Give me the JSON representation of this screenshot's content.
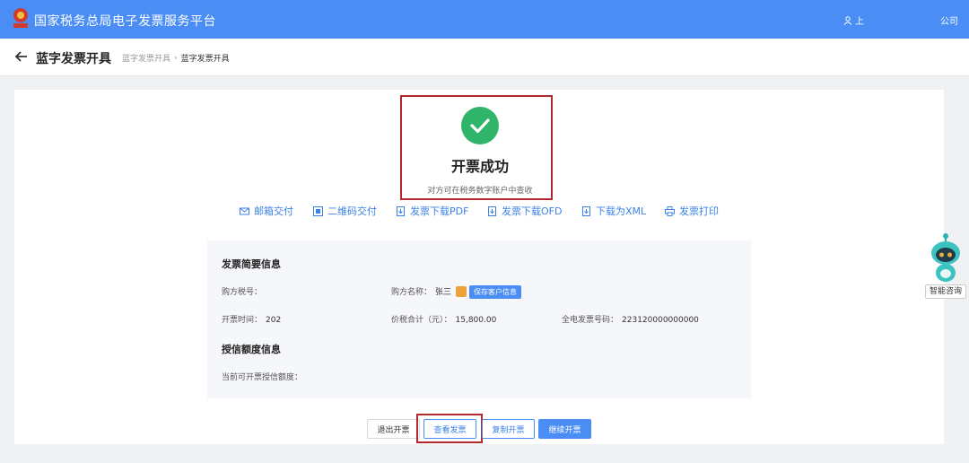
{
  "header": {
    "app_title": "国家税务总局电子发票服务平台",
    "user": "上",
    "company": "公司"
  },
  "subheader": {
    "page_title": "蓝字发票开具",
    "breadcrumb": [
      "蓝字发票开具",
      "蓝字发票开具"
    ]
  },
  "result": {
    "title": "开票成功",
    "subtitle": "对方可在税务数字账户中查收"
  },
  "actions": [
    {
      "label": "邮箱交付",
      "icon": "mail-icon"
    },
    {
      "label": "二维码交付",
      "icon": "qrcode-icon"
    },
    {
      "label": "发票下载PDF",
      "icon": "download-pdf-icon"
    },
    {
      "label": "发票下载OFD",
      "icon": "download-ofd-icon"
    },
    {
      "label": "下载为XML",
      "icon": "download-xml-icon"
    },
    {
      "label": "发票打印",
      "icon": "printer-icon"
    }
  ],
  "summary": {
    "title": "发票简要信息",
    "buyer_tax_id_label": "购方税号：",
    "buyer_tax_id": "",
    "buyer_name_label": "购方名称：",
    "buyer_name": "张三",
    "save_customer_label": "保存客户信息",
    "issue_time_label": "开票时间：",
    "issue_time": "202",
    "total_label": "价税合计（元）：",
    "total": "15,800.00",
    "invoice_no_label": "全电发票号码：",
    "invoice_no": "223120000000000"
  },
  "credit": {
    "title": "授信额度信息",
    "available_label": "当前可开票授信额度：",
    "available": ""
  },
  "buttons": {
    "exit": "退出开票",
    "view": "查看发票",
    "copy": "复制开票",
    "continue": "继续开票"
  },
  "assistant": {
    "label": "智能咨询"
  },
  "colors": {
    "primary": "#4a8ef5",
    "success": "#2fb56a",
    "highlight": "#b3282d"
  }
}
